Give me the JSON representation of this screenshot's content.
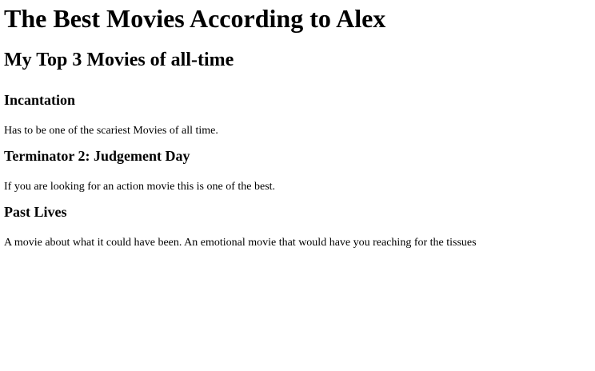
{
  "page": {
    "title": "The Best Movies According to Alex",
    "subtitle": "My Top 3 Movies of all-time"
  },
  "movies": [
    {
      "title": "Incantation",
      "description": "Has to be one of the scariest Movies of all time."
    },
    {
      "title": "Terminator 2: Judgement Day",
      "description": "If you are looking for an action movie this is one of the best."
    },
    {
      "title": "Past Lives",
      "description": "A movie about what it could have been. An emotional movie that would have you reaching for the tissues"
    }
  ]
}
